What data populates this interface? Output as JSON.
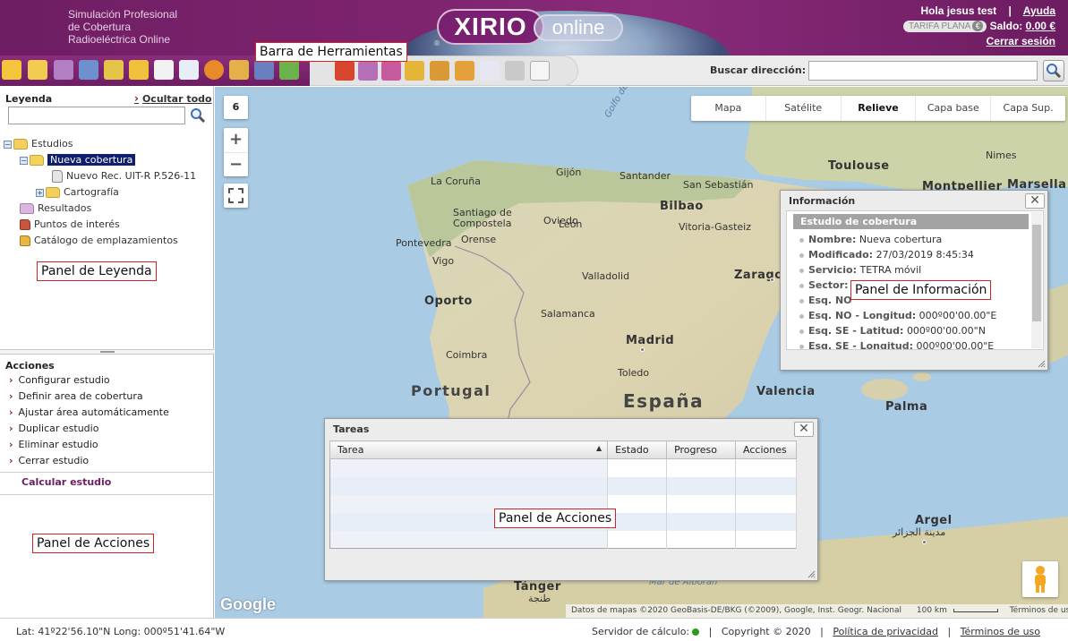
{
  "header": {
    "tagline_line1": "Simulación Profesional",
    "tagline_line2": "de Cobertura",
    "tagline_line3": "Radioeléctrica Online",
    "logo_main": "XIRIO",
    "logo_sub": "online",
    "logo_reg": "®",
    "greeting": "Hola jesus test",
    "separator": "|",
    "help_link": "Ayuda",
    "plan_badge": "TARIFA PLANA",
    "plan_currency": "€",
    "balance_label": "Saldo:",
    "balance_value": "0.00 €",
    "logout_link": "Cerrar sesión"
  },
  "toolbar": {
    "search_label": "Buscar dirección:",
    "search_value": ""
  },
  "legend": {
    "title": "Leyenda",
    "hide_all": "Ocultar todo",
    "filter_value": "",
    "tree": {
      "estudios": "Estudios",
      "nueva_cobertura": "Nueva cobertura",
      "recommendation": "Nuevo Rec. UIT-R P.526-11",
      "cartografia": "Cartografía",
      "resultados": "Resultados",
      "puntos": "Puntos de interés",
      "catalogo": "Catálogo de emplazamientos"
    }
  },
  "actions": {
    "title": "Acciones",
    "items": [
      "Configurar estudio",
      "Definir area de cobertura",
      "Ajustar área automáticamente",
      "Duplicar estudio",
      "Eliminar estudio",
      "Cerrar estudio"
    ],
    "calculate": "Calcular estudio"
  },
  "callouts": {
    "toolbar": "Barra de Herramientas",
    "legend": "Panel de Leyenda",
    "actions_left": "Panel de Acciones",
    "info": "Panel de Información",
    "actions_center": "Panel de Acciones"
  },
  "map": {
    "zoom_level": "6",
    "zoom_in": "+",
    "zoom_out": "−",
    "types": [
      "Mapa",
      "Satélite",
      "Relieve",
      "Capa base",
      "Capa Sup."
    ],
    "active_type": "Relieve",
    "google_logo": "Google",
    "attribution": "Datos de mapas ©2020 GeoBasis-DE/BKG (©2009), Google, Inst. Geogr. Nacional",
    "scale": "100 km",
    "terms": "Términos de uso",
    "labels": {
      "golfo": "Golfo de",
      "gijon": "Gijón",
      "santander": "Santander",
      "coruna": "La Coruña",
      "sansebastian": "San Sebastián",
      "bilbao": "Bilbao",
      "santiago1": "Santiago de",
      "santiago2": "Compostela",
      "oviedo": "Oviedo",
      "leon": "León",
      "vitoria": "Vitoria-Gasteiz",
      "pontevedra": "Pontevedra",
      "orense": "Orense",
      "vigo": "Vigo",
      "valladolid": "Valladolid",
      "zaragoza": "Zaragoza",
      "oporto": "Oporto",
      "salamanca": "Salamanca",
      "madrid": "Madrid",
      "coimbra": "Coimbra",
      "toledo": "Toledo",
      "portugal": "Portugal",
      "espana": "España",
      "valencia": "Valencia",
      "palma": "Palma",
      "toulouse": "Toulouse",
      "nimes": "Nimes",
      "montpellier": "Montpellier",
      "marsella": "Marsella",
      "argel": "Argel",
      "argel_ar": "مدينة الجزائر",
      "tanger": "Tánger",
      "tanger_ar": "طنجة",
      "alboran": "Mar de Alborán"
    }
  },
  "info_panel": {
    "title": "Información",
    "close": "✕",
    "section": "Estudio de cobertura",
    "rows": [
      {
        "label": "Nombre:",
        "value": "Nueva cobertura"
      },
      {
        "label": "Modificado:",
        "value": "27/03/2019 8:45:34"
      },
      {
        "label": "Servicio:",
        "value": "TETRA móvil"
      },
      {
        "label": "Sector:",
        "value": ""
      },
      {
        "label": "Esq. NO",
        "value": ""
      },
      {
        "label": "Esq. NO - Longitud:",
        "value": "000º00'00.00\"E"
      },
      {
        "label": "Esq. SE - Latitud:",
        "value": "000º00'00.00\"N"
      },
      {
        "label": "Esq. SE - Longitud:",
        "value": "000º00'00.00\"E"
      }
    ]
  },
  "tasks_panel": {
    "title": "Tareas",
    "close": "✕",
    "columns": [
      "Tarea",
      "Estado",
      "Progreso",
      "Acciones"
    ]
  },
  "footer": {
    "coords": "Lat: 41º22'56.10\"N Long: 000º51'41.64\"W",
    "server_label": "Servidor de cálculo:",
    "copyright": "Copyright © 2020",
    "privacy": "Política de privacidad",
    "terms": "Términos de uso",
    "separator": "|"
  },
  "colors": {
    "brand": "#6d1d62",
    "selection": "#0f1f6e",
    "callout_border": "#d02424",
    "server_ok": "#2a9c1a"
  }
}
